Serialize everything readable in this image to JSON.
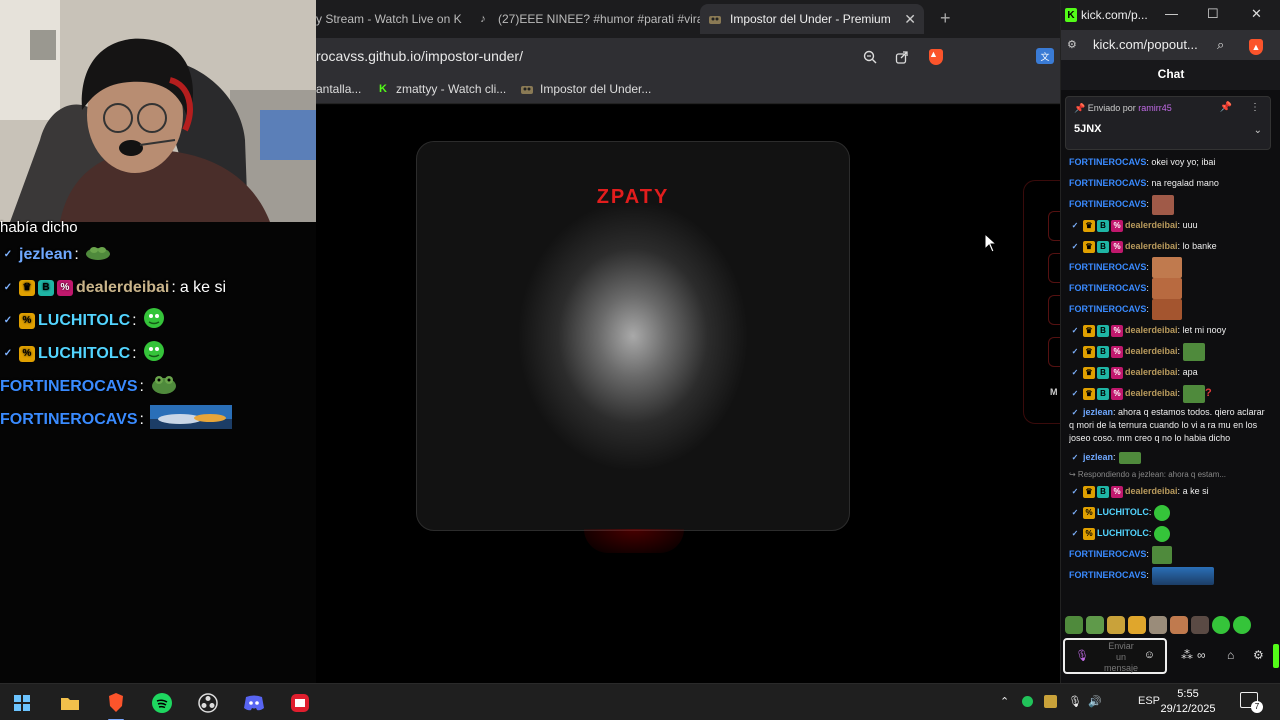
{
  "browser": {
    "tabs": [
      {
        "label": "y Stream - Watch Live on K",
        "icon": "kick-icon"
      },
      {
        "label": "(27)EEE NINEE? #humor #parati #vira",
        "icon": "tiktok-icon"
      },
      {
        "label": "Impostor del Under - Premium E",
        "icon": "game-favicon-icon"
      }
    ],
    "url": "rocavss.github.io/impostor-under/",
    "bookmarks": [
      {
        "label": "antalla...",
        "icon": ""
      },
      {
        "label": "zmattyy - Watch cli...",
        "icon": "kick-icon"
      },
      {
        "label": "Impostor del Under...",
        "icon": "game-favicon-icon"
      }
    ]
  },
  "game": {
    "title": "ZPATY",
    "side_label": "M"
  },
  "overlay_chat": {
    "partial_text": "había dicho",
    "lines": [
      {
        "user": "jezlean",
        "sep": ":",
        "text": "",
        "user_color": "#6fa8ff",
        "badges": [
          "verified-icon"
        ]
      },
      {
        "user": "dealerdeibai",
        "sep": ":",
        "text": "a ke si",
        "user_color": "#c9b48a",
        "badges": [
          "verified-icon",
          "crown-icon",
          "sub-badge-icon",
          "gift-badge-icon"
        ]
      },
      {
        "user": "LUCHITOLC",
        "sep": ":",
        "text": "",
        "user_color": "#53d5ff",
        "badges": [
          "verified-icon",
          "founder-badge-icon"
        ]
      },
      {
        "user": "LUCHITOLC",
        "sep": ":",
        "text": "",
        "user_color": "#53d5ff",
        "badges": [
          "verified-icon",
          "founder-badge-icon"
        ]
      },
      {
        "user": "FORTINEROCAVS",
        "sep": ":",
        "text": "",
        "user_color": "#3a8bff",
        "badges": []
      },
      {
        "user": "FORTINEROCAVS",
        "sep": ":",
        "text": "",
        "user_color": "#3a8bff",
        "badges": []
      }
    ]
  },
  "kick": {
    "window_title": "kick.com/p...",
    "url": "kick.com/popout...",
    "header": "Chat",
    "pinned": {
      "prefix": "Enviado por",
      "by": "ramirr45",
      "message": "5JNX"
    },
    "messages": [
      {
        "user": "FORTINEROCAVS",
        "sep": ":",
        "text": "okei voy yo; ibai",
        "style": ""
      },
      {
        "user": "FORTINEROCAVS",
        "sep": ":",
        "text": "na regalad mano",
        "style": ""
      },
      {
        "user": "FORTINEROCAVS",
        "sep": ":",
        "text": "",
        "style": ""
      },
      {
        "user": "dealerdeibai",
        "sep": ":",
        "text": "uuu",
        "style": "dealer"
      },
      {
        "user": "dealerdeibai",
        "sep": ":",
        "text": "lo banke",
        "style": "dealer"
      },
      {
        "user": "FORTINEROCAVS",
        "sep": ":",
        "text": "",
        "style": ""
      },
      {
        "user": "FORTINEROCAVS",
        "sep": ":",
        "text": "",
        "style": ""
      },
      {
        "user": "FORTINEROCAVS",
        "sep": ":",
        "text": "",
        "style": ""
      },
      {
        "user": "dealerdeibai",
        "sep": ":",
        "text": "let mi nooy",
        "style": "dealer"
      },
      {
        "user": "dealerdeibai",
        "sep": ":",
        "text": "",
        "style": "dealer"
      },
      {
        "user": "dealerdeibai",
        "sep": ":",
        "text": "apa",
        "style": "dealer"
      },
      {
        "user": "dealerdeibai",
        "sep": ":",
        "text": "?",
        "style": "dealer"
      },
      {
        "user": "jezlean",
        "sep": ":",
        "text": "ahora q estamos todos. qiero aclarar q mori de la ternura cuando lo vi a ra mu en los joseo coso. mm creo q no lo habia dicho",
        "style": "tall"
      },
      {
        "user": "jezlean",
        "sep": ":",
        "text": "",
        "style": ""
      },
      {
        "user": "",
        "sep": "",
        "text": "↪ Respondiendo a jezlean: ahora q estam...",
        "style": "reply"
      },
      {
        "user": "dealerdeibai",
        "sep": ":",
        "text": "a ke si",
        "style": "dealer"
      },
      {
        "user": "LUCHITOLC",
        "sep": ":",
        "text": "",
        "style": "green"
      },
      {
        "user": "LUCHITOLC",
        "sep": ":",
        "text": "",
        "style": "green"
      },
      {
        "user": "FORTINEROCAVS",
        "sep": ":",
        "text": "",
        "style": ""
      },
      {
        "user": "FORTINEROCAVS",
        "sep": ":",
        "text": "",
        "style": ""
      }
    ],
    "input_placeholder": "Enviar un mensaje"
  },
  "taskbar": {
    "apps": [
      "windows-start-icon",
      "file-explorer-icon",
      "brave-browser-icon",
      "spotify-icon",
      "obs-icon",
      "discord-icon",
      "red-app-icon"
    ],
    "language": "ESP",
    "time": "5:55",
    "date": "29/12/2025",
    "notifications": "7"
  },
  "colors": {
    "accent_kick": "#53fc18",
    "title_red": "#e21d1d",
    "username_blue": "#3a8bff"
  }
}
